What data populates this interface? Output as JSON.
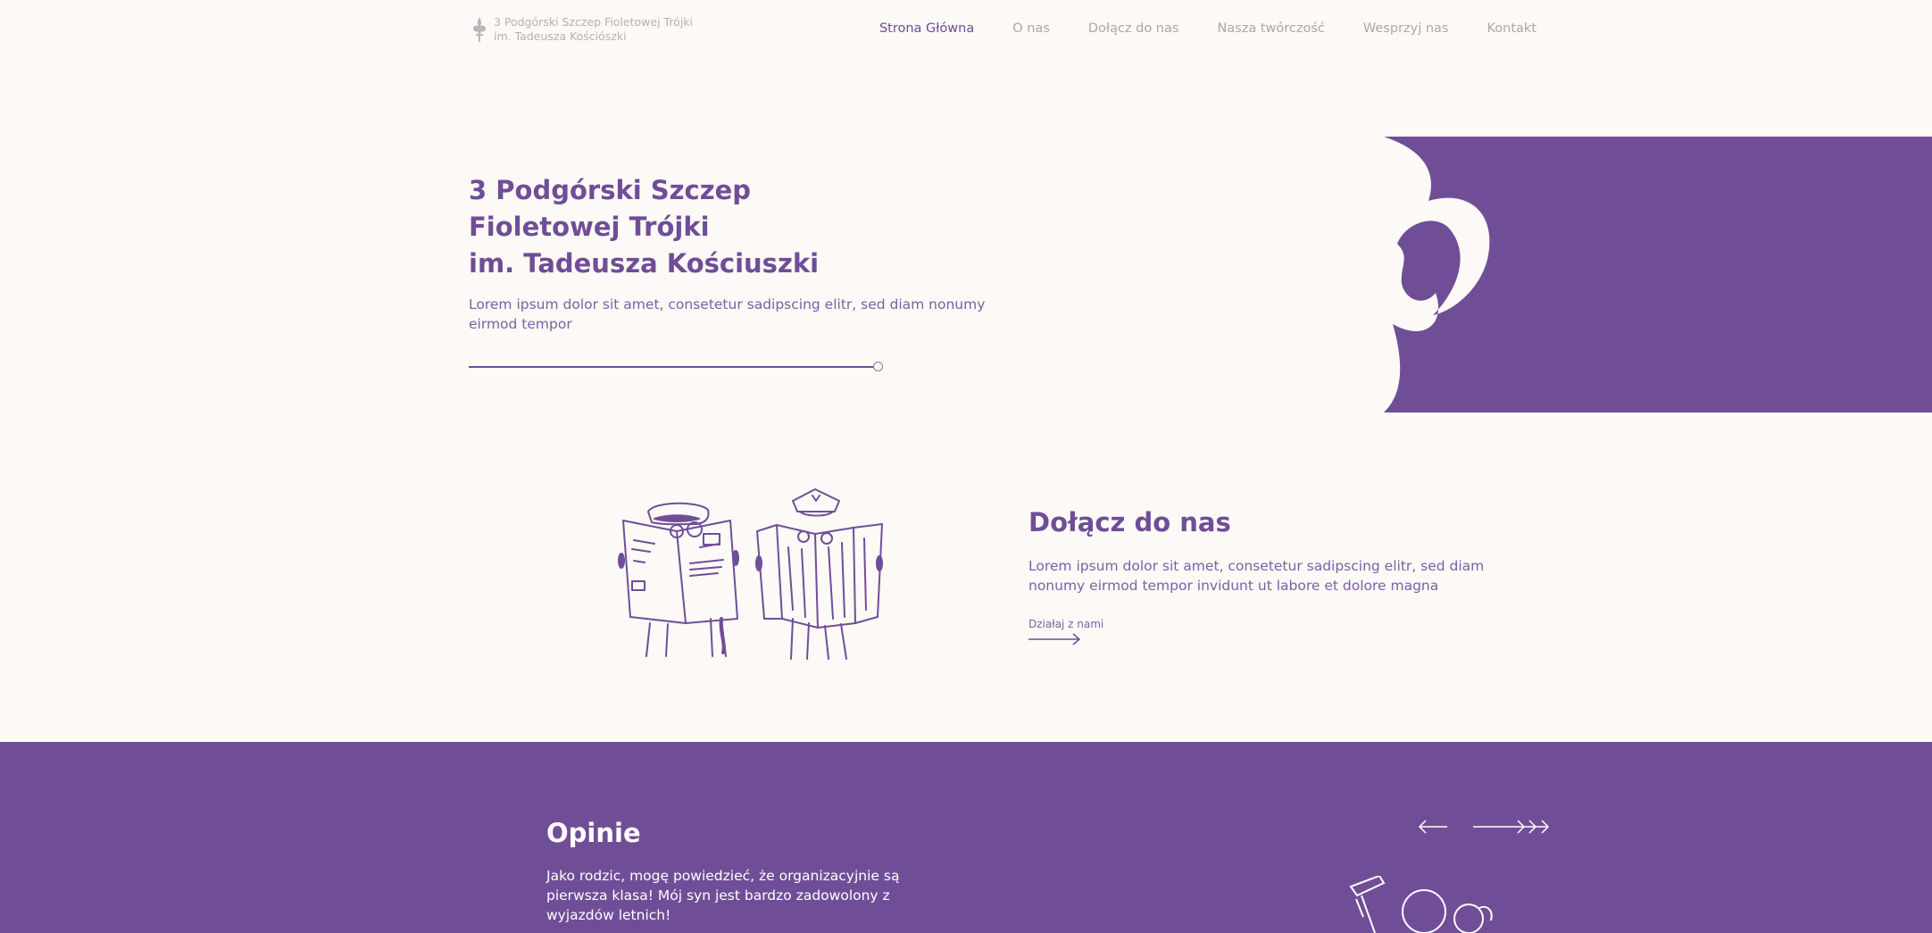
{
  "header": {
    "logo_line1": "3 Podgórski Szczep Fioletowej Trójki",
    "logo_line2": "im. Tadeusza Kościószki",
    "logo_icon": "fleur-de-lis-icon",
    "nav": [
      {
        "label": "Strona Główna",
        "active": true
      },
      {
        "label": "O nas",
        "active": false
      },
      {
        "label": "Dołącz do nas",
        "active": false
      },
      {
        "label": "Nasza twórczość",
        "active": false
      },
      {
        "label": "Wesprzyj nas",
        "active": false
      },
      {
        "label": "Kontakt",
        "active": false
      }
    ]
  },
  "hero": {
    "title_line1": "3 Podgórski Szczep",
    "title_line2": "Fioletowej Trójki",
    "title_line3": "im. Tadeusza Kościuszki",
    "subtitle": "Lorem ipsum dolor sit amet, consetetur sadipscing elitr, sed diam nonumy eirmod tempor",
    "slider_position": 1.0
  },
  "join": {
    "title": "Dołącz do nas",
    "text": "Lorem ipsum dolor sit amet, consetetur sadipscing elitr, sed diam nonumy eirmod tempor invidunt ut labore et dolore magna",
    "link_label": "Działaj z nami"
  },
  "opinions": {
    "title": "Opinie",
    "text": "Jako rodzic, mogę powiedzieć, że organizacyjnie są pierwsza klasa! Mój syn jest bardzo zadowolony z wyjazdów letnich!"
  },
  "colors": {
    "brand_purple": "#704e97",
    "background": "#fcf9f7",
    "nav_inactive": "#aaa7ac"
  }
}
